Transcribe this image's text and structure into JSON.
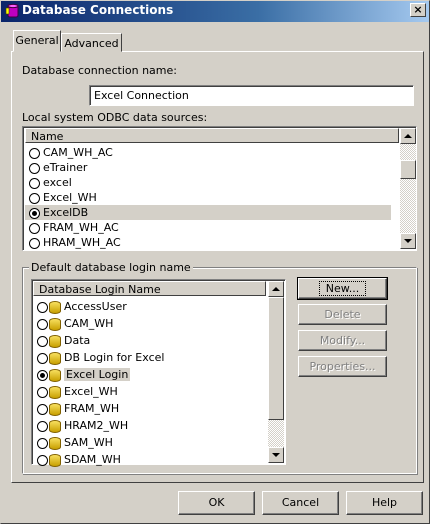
{
  "window": {
    "title": "Database Connections",
    "close_glyph": "×"
  },
  "tabs": [
    {
      "label": "General",
      "active": true
    },
    {
      "label": "Advanced",
      "active": false
    }
  ],
  "connection": {
    "label": "Database connection name:",
    "value": "Excel Connection"
  },
  "odbc": {
    "label": "Local system ODBC data sources:",
    "column_header": "Name",
    "items": [
      {
        "label": "CAM_WH_AC",
        "selected": false
      },
      {
        "label": "eTrainer",
        "selected": false
      },
      {
        "label": "excel",
        "selected": false
      },
      {
        "label": "Excel_WH",
        "selected": false
      },
      {
        "label": "ExcelDB",
        "selected": true
      },
      {
        "label": "FRAM_WH_AC",
        "selected": false
      },
      {
        "label": "HRAM_WH_AC",
        "selected": false
      }
    ]
  },
  "login": {
    "group_label": "Default database login name",
    "column_header": "Database Login Name",
    "items": [
      {
        "label": "AccessUser",
        "selected": false
      },
      {
        "label": "CAM_WH",
        "selected": false
      },
      {
        "label": "Data",
        "selected": false
      },
      {
        "label": "DB Login for Excel",
        "selected": false
      },
      {
        "label": "Excel Login",
        "selected": true
      },
      {
        "label": "Excel_WH",
        "selected": false
      },
      {
        "label": "FRAM_WH",
        "selected": false
      },
      {
        "label": "HRAM2_WH",
        "selected": false
      },
      {
        "label": "SAM_WH",
        "selected": false
      },
      {
        "label": "SDAM_WH",
        "selected": false
      }
    ],
    "buttons": {
      "new": "New...",
      "delete": "Delete",
      "modify": "Modify...",
      "properties": "Properties..."
    }
  },
  "footer": {
    "ok": "OK",
    "cancel": "Cancel",
    "help": "Help"
  },
  "colors": {
    "titlebar_start": "#0a246a",
    "face": "#d4d0c8"
  }
}
